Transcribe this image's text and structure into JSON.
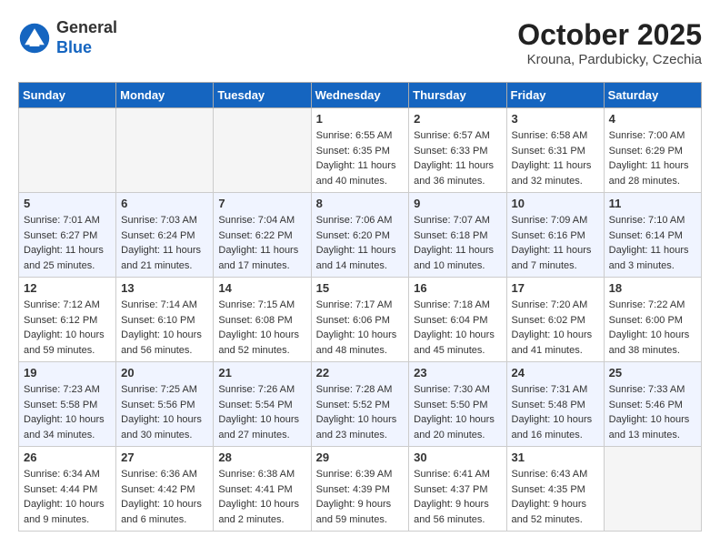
{
  "header": {
    "logo_general": "General",
    "logo_blue": "Blue",
    "month_title": "October 2025",
    "subtitle": "Krouna, Pardubicky, Czechia"
  },
  "weekdays": [
    "Sunday",
    "Monday",
    "Tuesday",
    "Wednesday",
    "Thursday",
    "Friday",
    "Saturday"
  ],
  "weeks": [
    [
      {
        "day": "",
        "empty": true
      },
      {
        "day": "",
        "empty": true
      },
      {
        "day": "",
        "empty": true
      },
      {
        "day": "1",
        "sunrise": "6:55 AM",
        "sunset": "6:35 PM",
        "daylight": "11 hours and 40 minutes."
      },
      {
        "day": "2",
        "sunrise": "6:57 AM",
        "sunset": "6:33 PM",
        "daylight": "11 hours and 36 minutes."
      },
      {
        "day": "3",
        "sunrise": "6:58 AM",
        "sunset": "6:31 PM",
        "daylight": "11 hours and 32 minutes."
      },
      {
        "day": "4",
        "sunrise": "7:00 AM",
        "sunset": "6:29 PM",
        "daylight": "11 hours and 28 minutes."
      }
    ],
    [
      {
        "day": "5",
        "sunrise": "7:01 AM",
        "sunset": "6:27 PM",
        "daylight": "11 hours and 25 minutes."
      },
      {
        "day": "6",
        "sunrise": "7:03 AM",
        "sunset": "6:24 PM",
        "daylight": "11 hours and 21 minutes."
      },
      {
        "day": "7",
        "sunrise": "7:04 AM",
        "sunset": "6:22 PM",
        "daylight": "11 hours and 17 minutes."
      },
      {
        "day": "8",
        "sunrise": "7:06 AM",
        "sunset": "6:20 PM",
        "daylight": "11 hours and 14 minutes."
      },
      {
        "day": "9",
        "sunrise": "7:07 AM",
        "sunset": "6:18 PM",
        "daylight": "11 hours and 10 minutes."
      },
      {
        "day": "10",
        "sunrise": "7:09 AM",
        "sunset": "6:16 PM",
        "daylight": "11 hours and 7 minutes."
      },
      {
        "day": "11",
        "sunrise": "7:10 AM",
        "sunset": "6:14 PM",
        "daylight": "11 hours and 3 minutes."
      }
    ],
    [
      {
        "day": "12",
        "sunrise": "7:12 AM",
        "sunset": "6:12 PM",
        "daylight": "10 hours and 59 minutes."
      },
      {
        "day": "13",
        "sunrise": "7:14 AM",
        "sunset": "6:10 PM",
        "daylight": "10 hours and 56 minutes."
      },
      {
        "day": "14",
        "sunrise": "7:15 AM",
        "sunset": "6:08 PM",
        "daylight": "10 hours and 52 minutes."
      },
      {
        "day": "15",
        "sunrise": "7:17 AM",
        "sunset": "6:06 PM",
        "daylight": "10 hours and 48 minutes."
      },
      {
        "day": "16",
        "sunrise": "7:18 AM",
        "sunset": "6:04 PM",
        "daylight": "10 hours and 45 minutes."
      },
      {
        "day": "17",
        "sunrise": "7:20 AM",
        "sunset": "6:02 PM",
        "daylight": "10 hours and 41 minutes."
      },
      {
        "day": "18",
        "sunrise": "7:22 AM",
        "sunset": "6:00 PM",
        "daylight": "10 hours and 38 minutes."
      }
    ],
    [
      {
        "day": "19",
        "sunrise": "7:23 AM",
        "sunset": "5:58 PM",
        "daylight": "10 hours and 34 minutes."
      },
      {
        "day": "20",
        "sunrise": "7:25 AM",
        "sunset": "5:56 PM",
        "daylight": "10 hours and 30 minutes."
      },
      {
        "day": "21",
        "sunrise": "7:26 AM",
        "sunset": "5:54 PM",
        "daylight": "10 hours and 27 minutes."
      },
      {
        "day": "22",
        "sunrise": "7:28 AM",
        "sunset": "5:52 PM",
        "daylight": "10 hours and 23 minutes."
      },
      {
        "day": "23",
        "sunrise": "7:30 AM",
        "sunset": "5:50 PM",
        "daylight": "10 hours and 20 minutes."
      },
      {
        "day": "24",
        "sunrise": "7:31 AM",
        "sunset": "5:48 PM",
        "daylight": "10 hours and 16 minutes."
      },
      {
        "day": "25",
        "sunrise": "7:33 AM",
        "sunset": "5:46 PM",
        "daylight": "10 hours and 13 minutes."
      }
    ],
    [
      {
        "day": "26",
        "sunrise": "6:34 AM",
        "sunset": "4:44 PM",
        "daylight": "10 hours and 9 minutes."
      },
      {
        "day": "27",
        "sunrise": "6:36 AM",
        "sunset": "4:42 PM",
        "daylight": "10 hours and 6 minutes."
      },
      {
        "day": "28",
        "sunrise": "6:38 AM",
        "sunset": "4:41 PM",
        "daylight": "10 hours and 2 minutes."
      },
      {
        "day": "29",
        "sunrise": "6:39 AM",
        "sunset": "4:39 PM",
        "daylight": "9 hours and 59 minutes."
      },
      {
        "day": "30",
        "sunrise": "6:41 AM",
        "sunset": "4:37 PM",
        "daylight": "9 hours and 56 minutes."
      },
      {
        "day": "31",
        "sunrise": "6:43 AM",
        "sunset": "4:35 PM",
        "daylight": "9 hours and 52 minutes."
      },
      {
        "day": "",
        "empty": true
      }
    ]
  ]
}
